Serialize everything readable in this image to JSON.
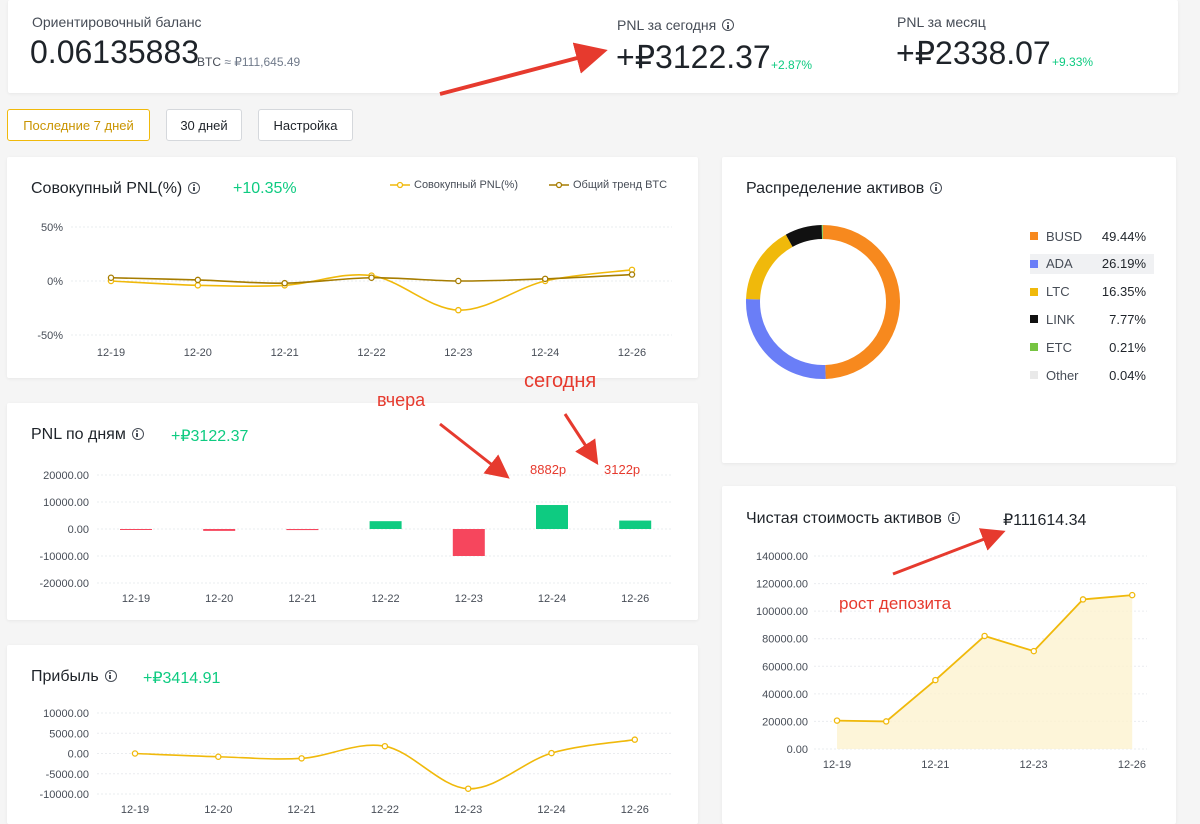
{
  "balance": {
    "label": "Ориентировочный баланс",
    "value": "0.06135883",
    "unit": "BTC",
    "approx": "≈ ₽111,645.49"
  },
  "pnl_today": {
    "label": "PNL за сегодня",
    "value": "+₽3122.37",
    "change": "+2.87%"
  },
  "pnl_month": {
    "label": "PNL за месяц",
    "value": "+₽2338.07",
    "change": "+9.33%"
  },
  "filters": {
    "last7": "Последние 7 дней",
    "days30": "30 дней",
    "settings": "Настройка"
  },
  "cumulative": {
    "title": "Совокупный PNL(%)",
    "value": "+10.35%",
    "legend1": "Совокупный PNL(%)",
    "legend2": "Общий тренд BTC"
  },
  "daily": {
    "title": "PNL по дням",
    "value": "+₽3122.37"
  },
  "profit": {
    "title": "Прибыль",
    "value": "+₽3414.91"
  },
  "allocation": {
    "title": "Распределение активов"
  },
  "networth": {
    "title": "Чистая стоимость активов",
    "value": "₽111614.34"
  },
  "annotations": {
    "yesterday": "вчера",
    "today": "сегодня",
    "yesterday_value": "8882р",
    "today_value": "3122р",
    "deposit_growth": "рост депозита"
  },
  "colors": {
    "yellow": "#f0b90b",
    "brown": "#a67c00",
    "green": "#0ecb81",
    "red": "#f6465d",
    "annotation": "#e63a2e"
  },
  "chart_data": [
    {
      "type": "line",
      "title": "Совокупный PNL(%)",
      "x": [
        "12-19",
        "12-20",
        "12-21",
        "12-22",
        "12-23",
        "12-24",
        "12-26"
      ],
      "yticks": [
        "50%",
        "0%",
        "-50%"
      ],
      "ylim": [
        -50,
        50
      ],
      "series": [
        {
          "name": "Совокупный PNL(%)",
          "color": "#f0b90b",
          "values": [
            0,
            -4,
            -4,
            5,
            -27,
            0,
            10.35
          ]
        },
        {
          "name": "Общий тренд BTC",
          "color": "#a67c00",
          "values": [
            3,
            1,
            -2,
            3,
            0,
            2,
            6
          ]
        }
      ]
    },
    {
      "type": "bar",
      "title": "PNL по дням",
      "categories": [
        "12-19",
        "12-20",
        "12-21",
        "12-22",
        "12-23",
        "12-24",
        "12-26"
      ],
      "yticks": [
        "20000.00",
        "10000.00",
        "0.00",
        "-10000.00",
        "-20000.00"
      ],
      "ylim": [
        -20000,
        20000
      ],
      "values": [
        -200,
        -700,
        -400,
        2900,
        -10000,
        8882,
        3122
      ]
    },
    {
      "type": "line",
      "title": "Прибыль",
      "x": [
        "12-19",
        "12-20",
        "12-21",
        "12-22",
        "12-23",
        "12-24",
        "12-26"
      ],
      "yticks": [
        "10000.00",
        "5000.00",
        "0.00",
        "-5000.00",
        "-10000.00"
      ],
      "ylim": [
        -10000,
        10000
      ],
      "values": [
        0,
        -800,
        -1200,
        1800,
        -8700,
        100,
        3414.91
      ]
    },
    {
      "type": "pie",
      "title": "Распределение активов",
      "slices": [
        {
          "name": "BUSD",
          "pct": "49.44%",
          "value": 49.44,
          "color": "#f7891e"
        },
        {
          "name": "ADA",
          "pct": "26.19%",
          "value": 26.19,
          "color": "#6a7ef7"
        },
        {
          "name": "LTC",
          "pct": "16.35%",
          "value": 16.35,
          "color": "#f0b90b"
        },
        {
          "name": "LINK",
          "pct": "7.77%",
          "value": 7.77,
          "color": "#111111"
        },
        {
          "name": "ETC",
          "pct": "0.21%",
          "value": 0.21,
          "color": "#76c442"
        },
        {
          "name": "Other",
          "pct": "0.04%",
          "value": 0.04,
          "color": "#e9e9e9"
        }
      ]
    },
    {
      "type": "area",
      "title": "Чистая стоимость активов",
      "x_ticks": [
        "12-19",
        "12-21",
        "12-23",
        "12-26"
      ],
      "yticks": [
        "140000.00",
        "120000.00",
        "100000.00",
        "80000.00",
        "60000.00",
        "40000.00",
        "20000.00",
        "0.00"
      ],
      "ylim": [
        0,
        140000
      ],
      "values": [
        20600,
        20000,
        50000,
        82000,
        71000,
        108500,
        111614.34
      ]
    }
  ]
}
